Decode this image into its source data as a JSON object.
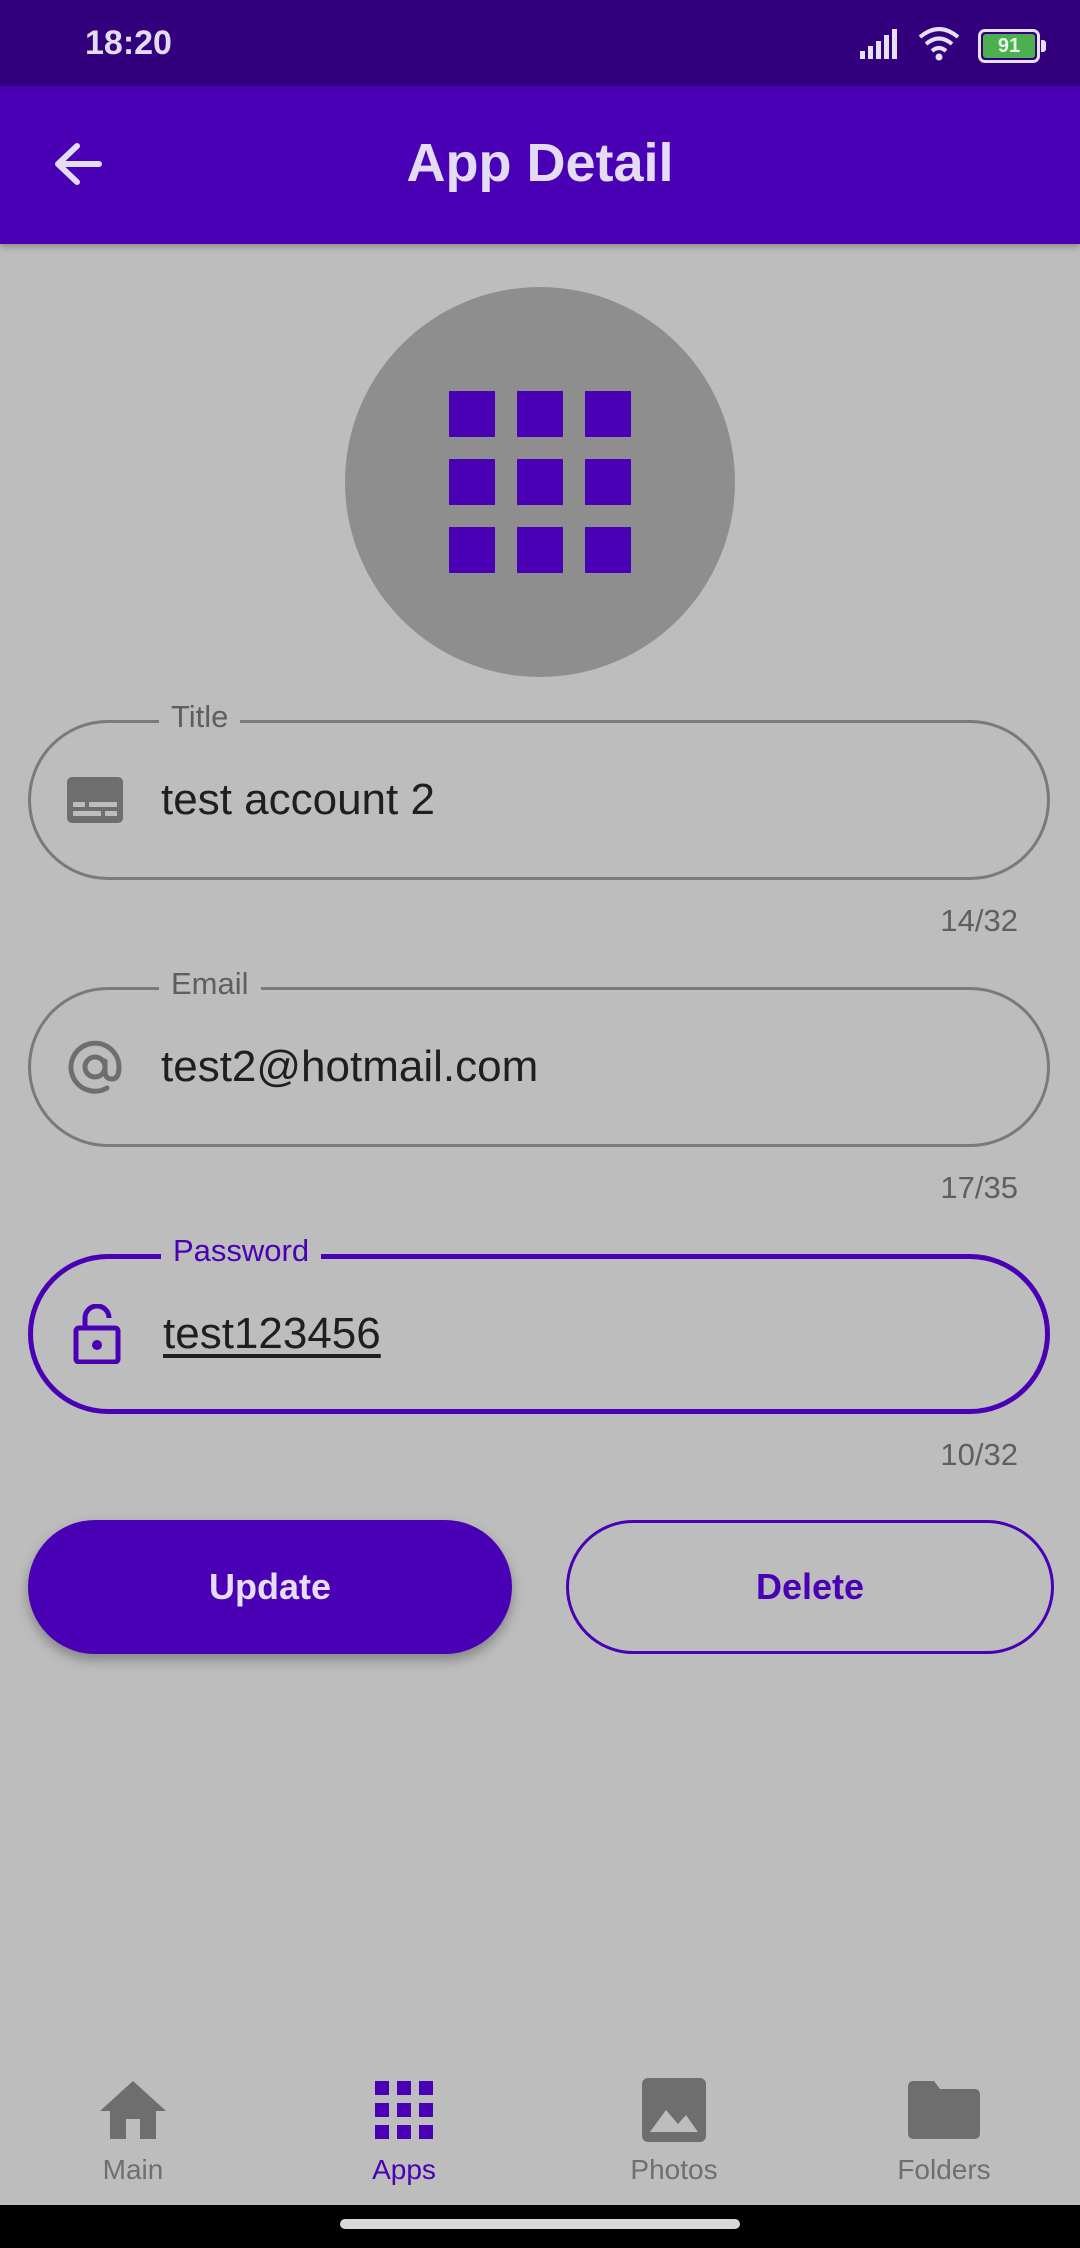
{
  "status_bar": {
    "time": "18:20",
    "battery": "91"
  },
  "app_bar": {
    "title": "App Detail"
  },
  "fields": {
    "title": {
      "label": "Title",
      "value": "test account 2",
      "counter": "14/32"
    },
    "email": {
      "label": "Email",
      "value": "test2@hotmail.com",
      "counter": "17/35"
    },
    "password": {
      "label": "Password",
      "value": "test123456",
      "counter": "10/32"
    }
  },
  "actions": {
    "update_label": "Update",
    "delete_label": "Delete"
  },
  "nav": {
    "items": [
      {
        "label": "Main",
        "icon": "home-icon"
      },
      {
        "label": "Apps",
        "icon": "apps-grid-icon"
      },
      {
        "label": "Photos",
        "icon": "image-icon"
      },
      {
        "label": "Folders",
        "icon": "folder-icon"
      }
    ],
    "active": "Apps"
  },
  "colors": {
    "primary": "#4a00b5",
    "status_bar": "#33007d",
    "background": "#bdbdbd"
  }
}
